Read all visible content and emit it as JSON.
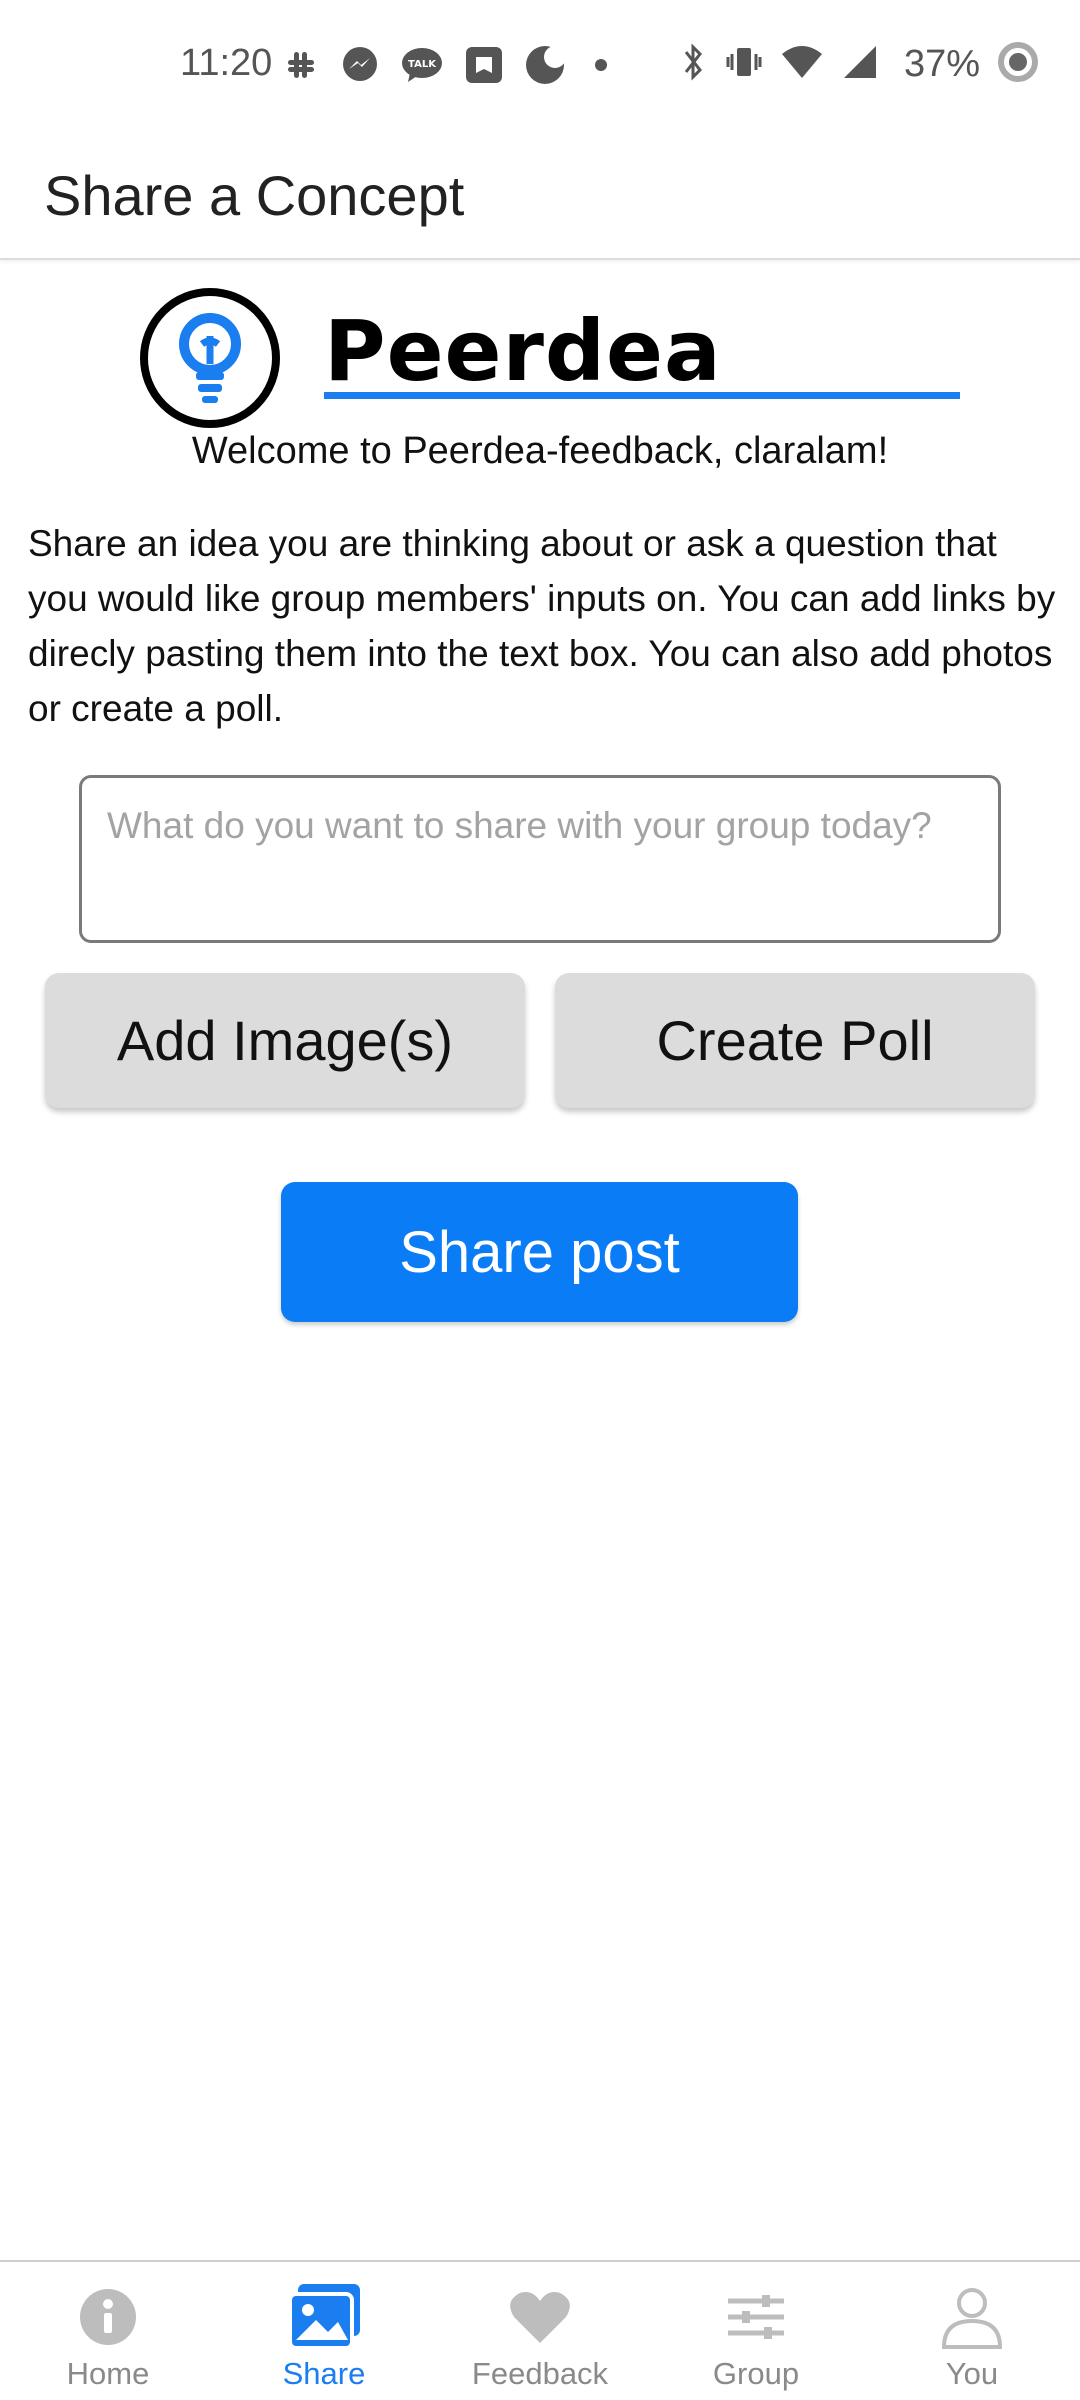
{
  "status_bar": {
    "time": "11:20",
    "battery_percent": "37%",
    "left_icons": [
      "slack-icon",
      "messenger-icon",
      "talk-icon",
      "notification-app-icon",
      "moon-icon",
      "dot-icon"
    ],
    "right_icons": [
      "bluetooth-icon",
      "vibrate-icon",
      "wifi-icon",
      "signal-icon",
      "battery-ring-icon"
    ]
  },
  "app_bar": {
    "title": "Share a Concept"
  },
  "logo": {
    "wordmark": "Peerdea",
    "icon": "lightbulb-icon"
  },
  "welcome_text": "Welcome to Peerdea-feedback, claralam!",
  "intro_text": "Share an idea you are thinking about or ask a question that you would like group members' inputs on. You can add links by direcly pasting them into the text box. You can also add photos or create a poll.",
  "share_input": {
    "value": "",
    "placeholder": "What do you want to share with your group today?"
  },
  "buttons": {
    "add_images": "Add Image(s)",
    "create_poll": "Create Poll",
    "share_post": "Share post"
  },
  "bottom_nav": {
    "items": [
      {
        "label": "Home",
        "icon": "info-icon",
        "active": false
      },
      {
        "label": "Share",
        "icon": "image-icon",
        "active": true
      },
      {
        "label": "Feedback",
        "icon": "heart-icon",
        "active": false
      },
      {
        "label": "Group",
        "icon": "sliders-icon",
        "active": false
      },
      {
        "label": "You",
        "icon": "person-icon",
        "active": false
      }
    ]
  },
  "colors": {
    "accent": "#1a7ef0",
    "share_button": "#0a7cf5",
    "secondary_button": "#dcdcdc",
    "inactive_nav": "#8a8a8a"
  }
}
